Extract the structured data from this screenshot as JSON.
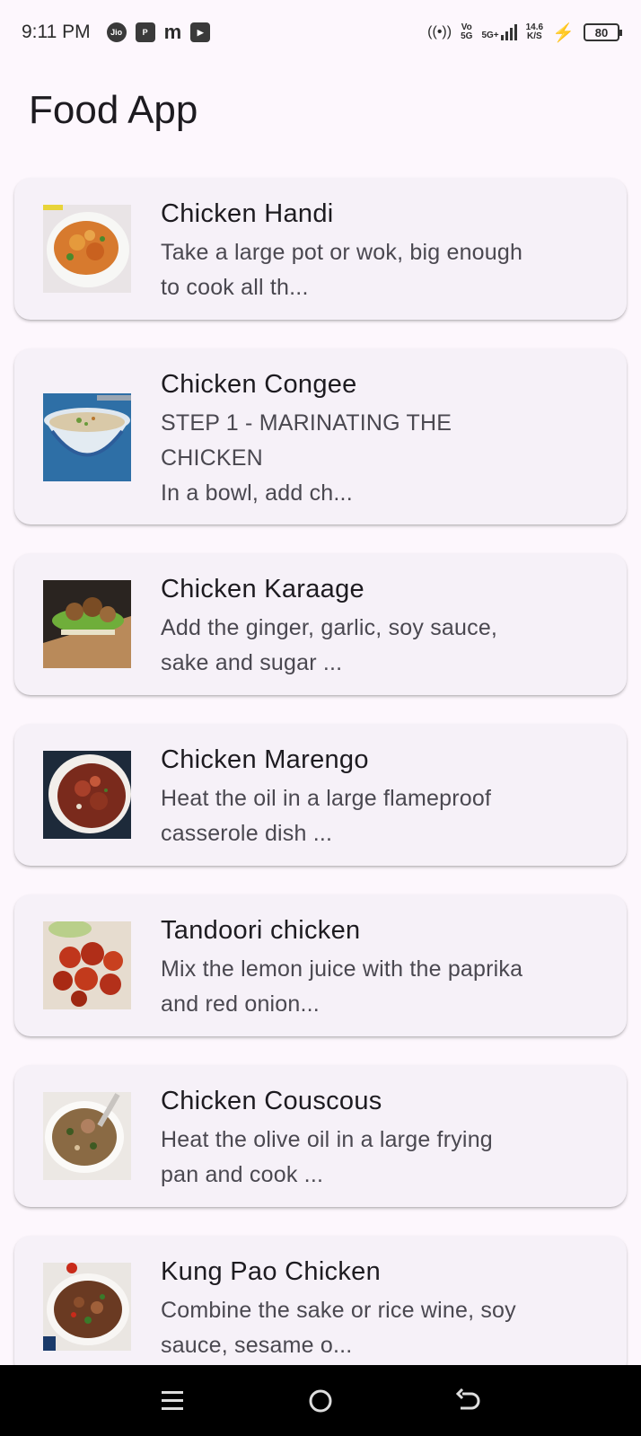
{
  "status_bar": {
    "time": "9:11 PM",
    "left_icons": [
      "jio-icon",
      "paytm-icon",
      "m-app-icon",
      "youtube-icon"
    ],
    "network_label_top": "Vo",
    "network_label_bottom": "5G",
    "signal_type": "5G+",
    "speed_value": "14.6",
    "speed_unit": "K/S",
    "battery": "80"
  },
  "app": {
    "title": "Food App"
  },
  "recipes": [
    {
      "name": "Chicken Handi",
      "description": "Take a large pot or wok, big enough\nto cook all th...",
      "image": "chicken-handi-image"
    },
    {
      "name": "Chicken Congee",
      "description": "STEP 1 - MARINATING THE\nCHICKEN\nIn a bowl, add ch...",
      "image": "chicken-congee-image"
    },
    {
      "name": "Chicken Karaage",
      "description": "Add the ginger, garlic, soy sauce,\nsake and sugar ...",
      "image": "chicken-karaage-image"
    },
    {
      "name": "Chicken Marengo",
      "description": "Heat the oil in a large flameproof\ncasserole dish ...",
      "image": "chicken-marengo-image"
    },
    {
      "name": "Tandoori chicken",
      "description": "Mix the lemon juice with the paprika\nand red onion...",
      "image": "tandoori-chicken-image"
    },
    {
      "name": "Chicken Couscous",
      "description": "Heat the olive oil in a large frying\npan and cook ...",
      "image": "chicken-couscous-image"
    },
    {
      "name": "Kung Pao Chicken",
      "description": "Combine the sake or rice wine, soy\nsauce, sesame o...",
      "image": "kung-pao-chicken-image"
    }
  ],
  "nav_bar": {
    "buttons": [
      "menu-icon",
      "home-icon",
      "back-icon"
    ]
  },
  "colors": {
    "background": "#fdf7fd",
    "card": "#f6f1f8",
    "nav_bar": "#000000"
  }
}
